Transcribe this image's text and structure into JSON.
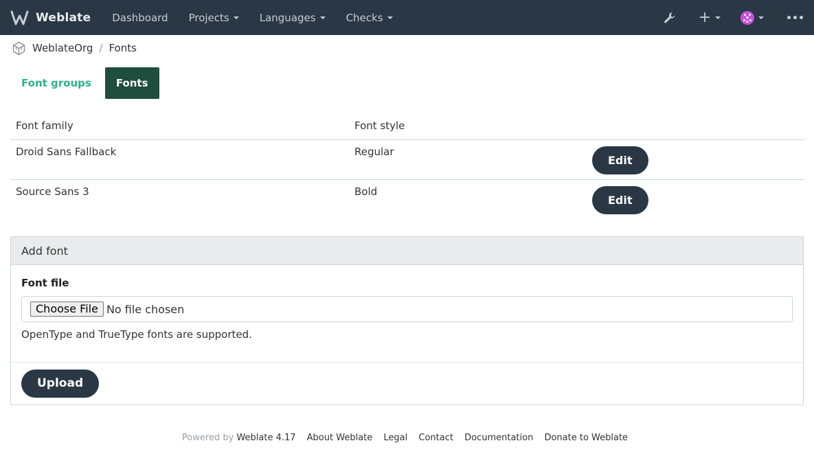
{
  "navbar": {
    "brand": "Weblate",
    "items": [
      {
        "label": "Dashboard",
        "dropdown": false
      },
      {
        "label": "Projects",
        "dropdown": true
      },
      {
        "label": "Languages",
        "dropdown": true
      },
      {
        "label": "Checks",
        "dropdown": true
      }
    ],
    "plus_label": "+",
    "icons": [
      "weblate-logo-icon",
      "wrench-icon",
      "plus-icon",
      "avatar-icon",
      "more-icon"
    ],
    "colors": {
      "bg": "#2a3744",
      "avatar": "#c34fd9"
    }
  },
  "breadcrumb": {
    "org": "WeblateOrg",
    "separator": "/",
    "current": "Fonts"
  },
  "tabs": [
    {
      "label": "Font groups",
      "active": false
    },
    {
      "label": "Fonts",
      "active": true
    }
  ],
  "table": {
    "headers": [
      "Font family",
      "Font style",
      ""
    ],
    "rows": [
      {
        "family": "Droid Sans Fallback",
        "style": "Regular",
        "action": "Edit"
      },
      {
        "family": "Source Sans 3",
        "style": "Bold",
        "action": "Edit"
      }
    ]
  },
  "add_font": {
    "title": "Add font",
    "field_label": "Font file",
    "choose_button": "Choose File",
    "no_file": "No file chosen",
    "help": "OpenType and TrueType fonts are supported.",
    "submit": "Upload"
  },
  "footer": {
    "powered_by": "Powered by",
    "links": [
      "Weblate 4.17",
      "About Weblate",
      "Legal",
      "Contact",
      "Documentation",
      "Donate to Weblate"
    ]
  },
  "colors": {
    "accent": "#2eb18d",
    "active_tab": "#1f4d3e",
    "button": "#2a3744"
  }
}
